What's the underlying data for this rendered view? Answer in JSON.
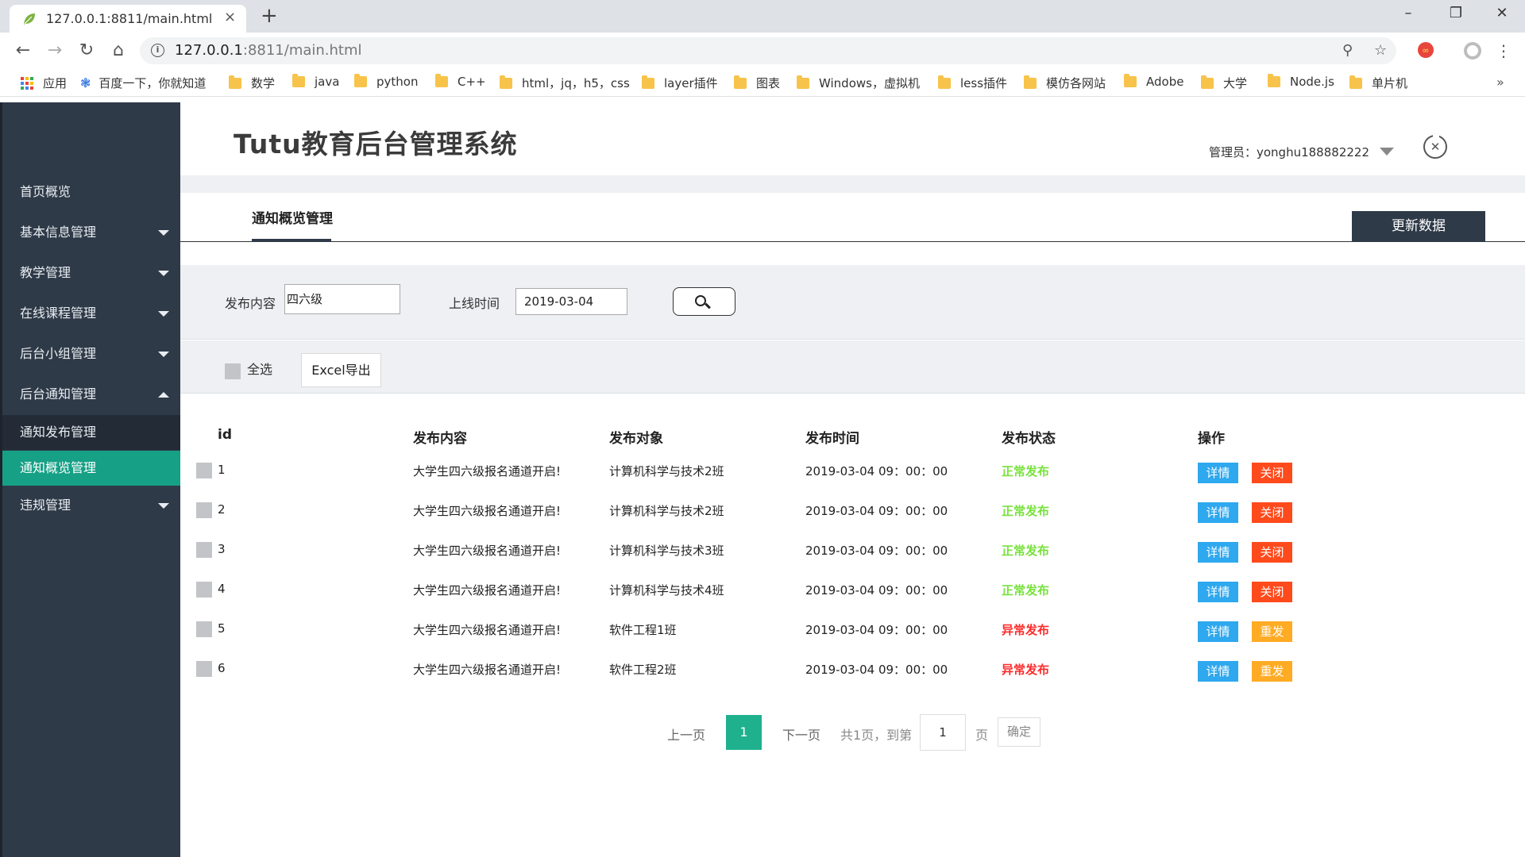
{
  "browser": {
    "tab_title": "127.0.0.1:8811/main.html",
    "tab_close": "×",
    "new_tab": "+",
    "url_host": "127.0.0.1",
    "url_rest": ":8811/main.html",
    "bookmarks": [
      {
        "label": "应用",
        "icon": "apps-grid-icon"
      },
      {
        "label": "百度一下，你就知道",
        "icon": "baidu-paw-icon"
      },
      {
        "label": "数学",
        "icon": "folder-icon"
      },
      {
        "label": "java",
        "icon": "folder-icon"
      },
      {
        "label": "python",
        "icon": "folder-icon"
      },
      {
        "label": "C++",
        "icon": "folder-icon"
      },
      {
        "label": "html，jq，h5，css",
        "icon": "folder-icon"
      },
      {
        "label": "layer插件",
        "icon": "folder-icon"
      },
      {
        "label": "图表",
        "icon": "folder-icon"
      },
      {
        "label": "Windows，虚拟机",
        "icon": "folder-icon"
      },
      {
        "label": "less插件",
        "icon": "folder-icon"
      },
      {
        "label": "模仿各网站",
        "icon": "folder-icon"
      },
      {
        "label": "Adobe",
        "icon": "folder-icon"
      },
      {
        "label": "大学",
        "icon": "folder-icon"
      },
      {
        "label": "Node.js",
        "icon": "folder-icon"
      },
      {
        "label": "单片机",
        "icon": "folder-icon"
      }
    ],
    "bookmarks_more": "»"
  },
  "header": {
    "app_title": "Tutu教育后台管理系统",
    "admin_label": "管理员：yonghu188882222"
  },
  "sidebar": {
    "items": [
      {
        "label": "首页概览",
        "caret": "none"
      },
      {
        "label": "基本信息管理",
        "caret": "down"
      },
      {
        "label": "教学管理",
        "caret": "down"
      },
      {
        "label": "在线课程管理",
        "caret": "down"
      },
      {
        "label": "后台小组管理",
        "caret": "down"
      },
      {
        "label": "后台通知管理",
        "caret": "up"
      },
      {
        "label": "通知发布管理",
        "caret": "none"
      },
      {
        "label": "通知概览管理",
        "caret": "none"
      },
      {
        "label": "违规管理",
        "caret": "down"
      }
    ]
  },
  "main": {
    "section_tab": "通知概览管理",
    "refresh_button": "更新数据",
    "filter": {
      "content_label": "发布内容",
      "content_value": "四六级",
      "time_label": "上线时间",
      "time_value": "2019-03-04"
    },
    "actions": {
      "select_all": "全选",
      "excel_export": "Excel导出"
    },
    "table": {
      "headers": [
        "id",
        "发布内容",
        "发布对象",
        "发布时间",
        "发布状态",
        "操作"
      ],
      "rows": [
        {
          "id": "1",
          "content": "大学生四六级报名通道开启!",
          "target": "计算机科学与技术2班",
          "time": "2019-03-04 09：00：00",
          "status": "正常发布",
          "status_type": "ok",
          "btn1": "详情",
          "btn2": "关闭"
        },
        {
          "id": "2",
          "content": "大学生四六级报名通道开启!",
          "target": "计算机科学与技术2班",
          "time": "2019-03-04 09：00：00",
          "status": "正常发布",
          "status_type": "ok",
          "btn1": "详情",
          "btn2": "关闭"
        },
        {
          "id": "3",
          "content": "大学生四六级报名通道开启!",
          "target": "计算机科学与技术3班",
          "time": "2019-03-04 09：00：00",
          "status": "正常发布",
          "status_type": "ok",
          "btn1": "详情",
          "btn2": "关闭"
        },
        {
          "id": "4",
          "content": "大学生四六级报名通道开启!",
          "target": "计算机科学与技术4班",
          "time": "2019-03-04 09：00：00",
          "status": "正常发布",
          "status_type": "ok",
          "btn1": "详情",
          "btn2": "关闭"
        },
        {
          "id": "5",
          "content": "大学生四六级报名通道开启!",
          "target": "软件工程1班",
          "time": "2019-03-04 09：00：00",
          "status": "异常发布",
          "status_type": "bad",
          "btn1": "详情",
          "btn2": "重发"
        },
        {
          "id": "6",
          "content": "大学生四六级报名通道开启!",
          "target": "软件工程2班",
          "time": "2019-03-04 09：00：00",
          "status": "异常发布",
          "status_type": "bad",
          "btn1": "详情",
          "btn2": "重发"
        }
      ]
    },
    "pager": {
      "prev": "上一页",
      "current": "1",
      "next": "下一页",
      "summary": "共1页，到第",
      "goto_value": "1",
      "page_unit": "页",
      "confirm": "确定"
    }
  },
  "colors": {
    "sidebar_bg": "#2f3a48",
    "active_teal": "#16a085",
    "status_ok": "#78e23d",
    "status_bad": "#ff2b2b",
    "btn_blue": "#2ea8ef",
    "btn_red": "#ff4a1c",
    "btn_orange": "#ffab24"
  }
}
